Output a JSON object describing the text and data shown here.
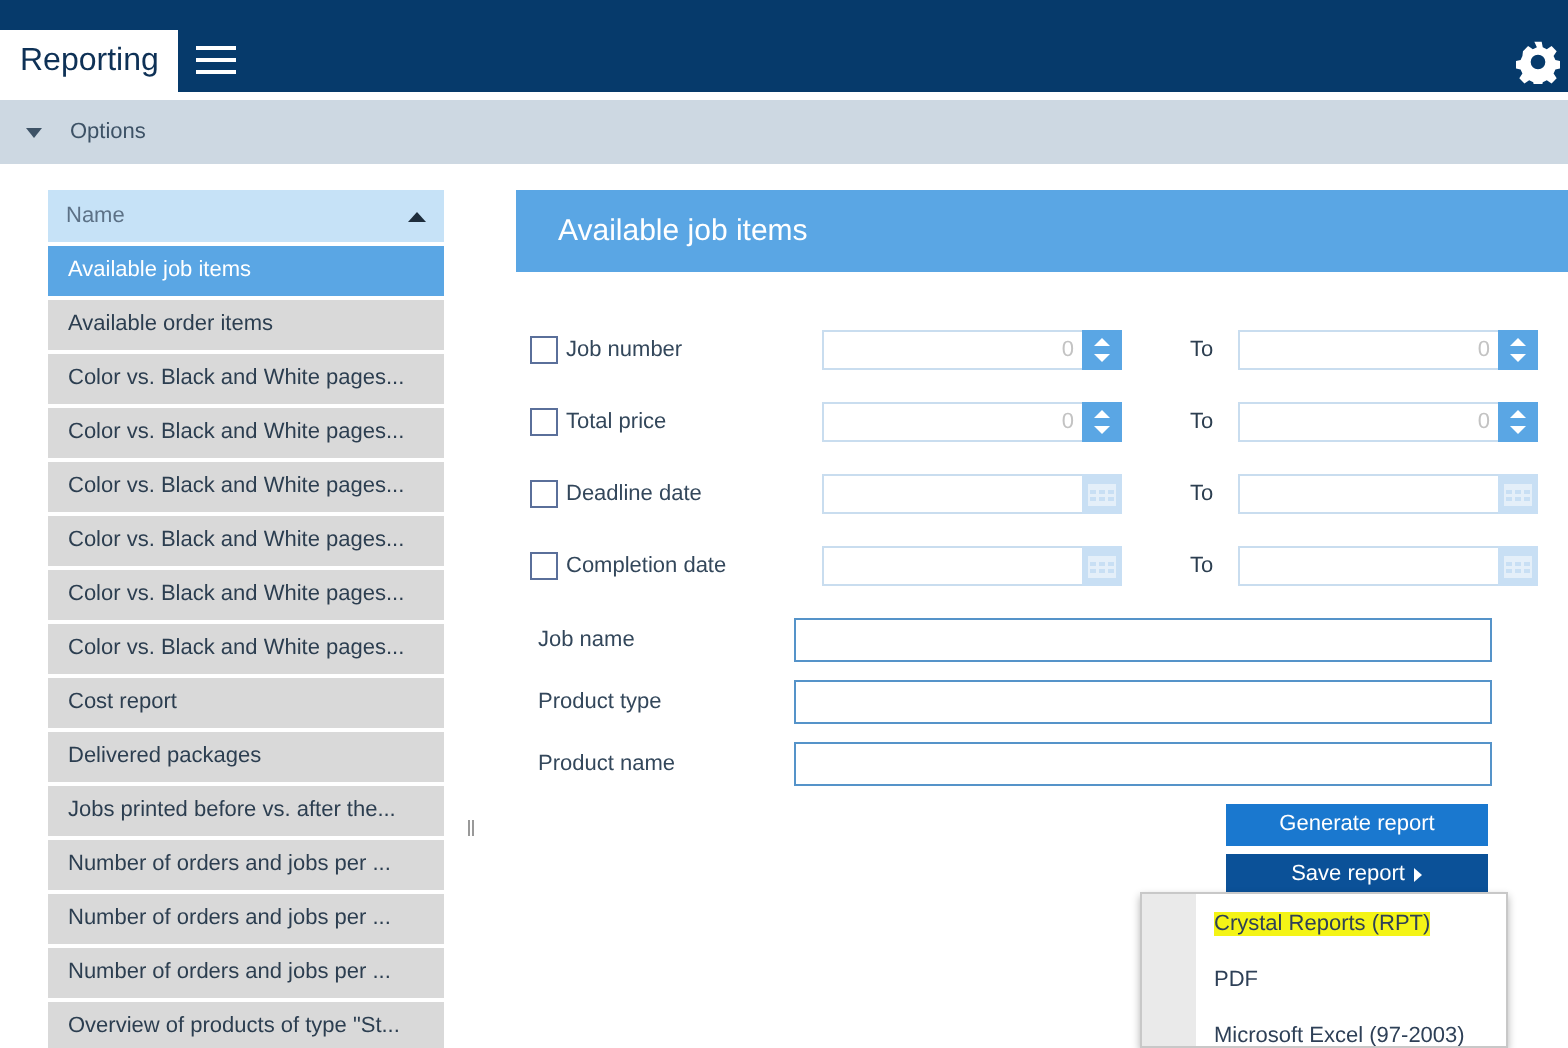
{
  "app": {
    "title": "Reporting"
  },
  "options_bar": {
    "label": "Options"
  },
  "sidebar": {
    "header": "Name",
    "items": [
      {
        "label": "Available job items",
        "selected": true
      },
      {
        "label": "Available order items",
        "selected": false
      },
      {
        "label": "Color vs. Black and White pages...",
        "selected": false
      },
      {
        "label": "Color vs. Black and White pages...",
        "selected": false
      },
      {
        "label": "Color vs. Black and White pages...",
        "selected": false
      },
      {
        "label": "Color vs. Black and White pages...",
        "selected": false
      },
      {
        "label": "Color vs. Black and White pages...",
        "selected": false
      },
      {
        "label": "Color vs. Black and White pages...",
        "selected": false
      },
      {
        "label": "Cost report",
        "selected": false
      },
      {
        "label": "Delivered packages",
        "selected": false
      },
      {
        "label": "Jobs printed before vs. after the...",
        "selected": false
      },
      {
        "label": "Number of orders and jobs per ...",
        "selected": false
      },
      {
        "label": "Number of orders and jobs per ...",
        "selected": false
      },
      {
        "label": "Number of orders and jobs per ...",
        "selected": false
      },
      {
        "label": "Overview of products of type \"St...",
        "selected": false
      }
    ]
  },
  "panel": {
    "title": "Available job items",
    "range_filters": [
      {
        "label": "Job number",
        "checked": false,
        "kind": "number",
        "from_value": "0",
        "to_label": "To",
        "to_value": "0"
      },
      {
        "label": "Total price",
        "checked": false,
        "kind": "number",
        "from_value": "0",
        "to_label": "To",
        "to_value": "0"
      },
      {
        "label": "Deadline date",
        "checked": false,
        "kind": "date",
        "to_label": "To"
      },
      {
        "label": "Completion date",
        "checked": false,
        "kind": "date",
        "to_label": "To"
      }
    ],
    "text_filters": [
      {
        "label": "Job name"
      },
      {
        "label": "Product type"
      },
      {
        "label": "Product name"
      }
    ],
    "buttons": [
      {
        "label": "Generate report",
        "kind": "generate"
      },
      {
        "label": "Save report",
        "kind": "save"
      }
    ],
    "save_menu": [
      {
        "label": "Crystal Reports (RPT)",
        "highlighted": true
      },
      {
        "label": "PDF",
        "highlighted": false
      },
      {
        "label": "Microsoft Excel (97-2003)",
        "highlighted": false
      }
    ]
  }
}
